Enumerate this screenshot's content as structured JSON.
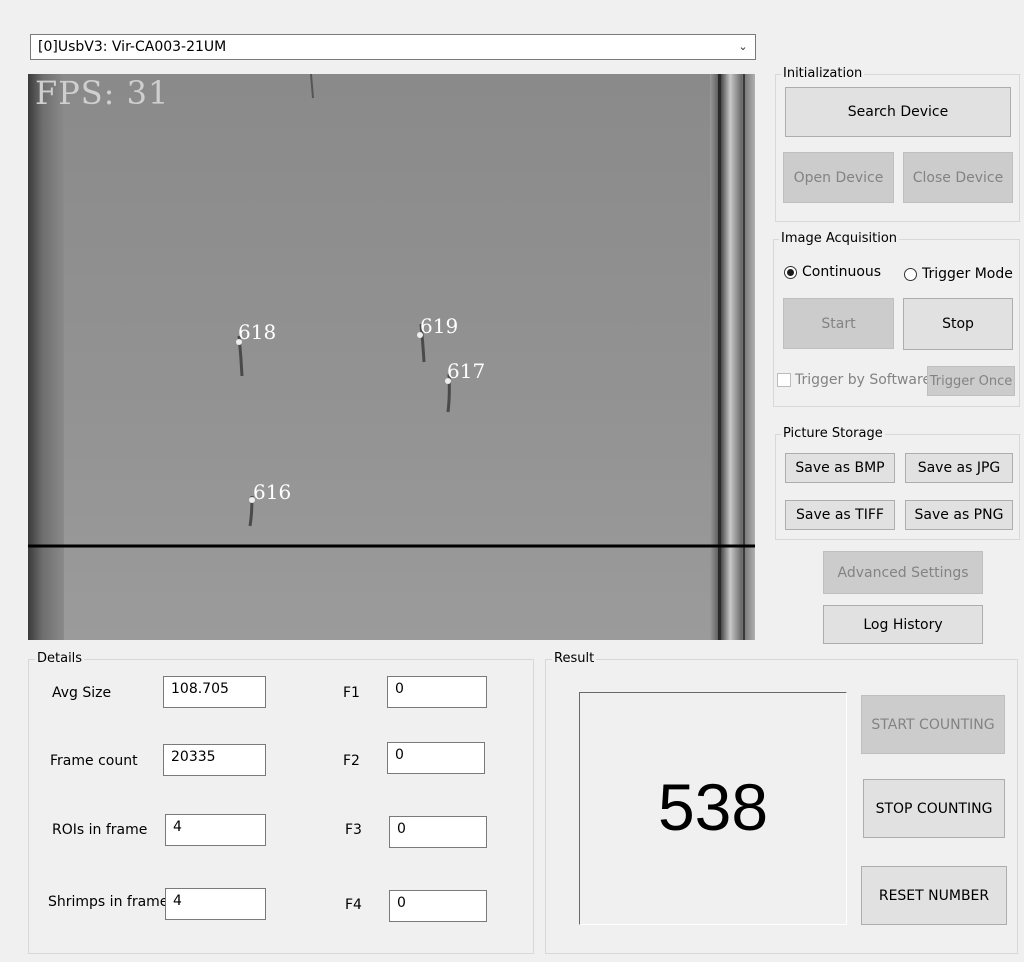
{
  "device": {
    "selected": "[0]UsbV3:  Vir-CA003-21UM"
  },
  "camera": {
    "fps_text": "FPS: 31",
    "labels": [
      "618",
      "619",
      "617",
      "616"
    ]
  },
  "initialization": {
    "title": "Initialization",
    "search": "Search Device",
    "open": "Open Device",
    "close": "Close Device"
  },
  "acquisition": {
    "title": "Image Acquisition",
    "continuous": "Continuous",
    "trigger_mode": "Trigger Mode",
    "start": "Start",
    "stop": "Stop",
    "trigger_software": "Trigger by Software",
    "trigger_once": "Trigger Once",
    "mode_selected": "Continuous"
  },
  "storage": {
    "title": "Picture Storage",
    "bmp": "Save as BMP",
    "jpg": "Save as JPG",
    "tiff": "Save as TIFF",
    "png": "Save as PNG"
  },
  "advanced": "Advanced Settings",
  "log": "Log History",
  "details": {
    "title": "Details",
    "avg_size_label": "Avg Size",
    "avg_size": "108.705",
    "frame_count_label": "Frame count",
    "frame_count": "20335",
    "rois_label": "ROIs in frame",
    "rois": "4",
    "shrimps_label": "Shrimps in frame",
    "shrimps": "4",
    "f1_label": "F1",
    "f1": "0",
    "f2_label": "F2",
    "f2": "0",
    "f3_label": "F3",
    "f3": "0",
    "f4_label": "F4",
    "f4": "0"
  },
  "result": {
    "title": "Result",
    "count": "538",
    "start_counting": "START COUNTING",
    "stop_counting": "STOP COUNTING",
    "reset": "RESET NUMBER"
  }
}
